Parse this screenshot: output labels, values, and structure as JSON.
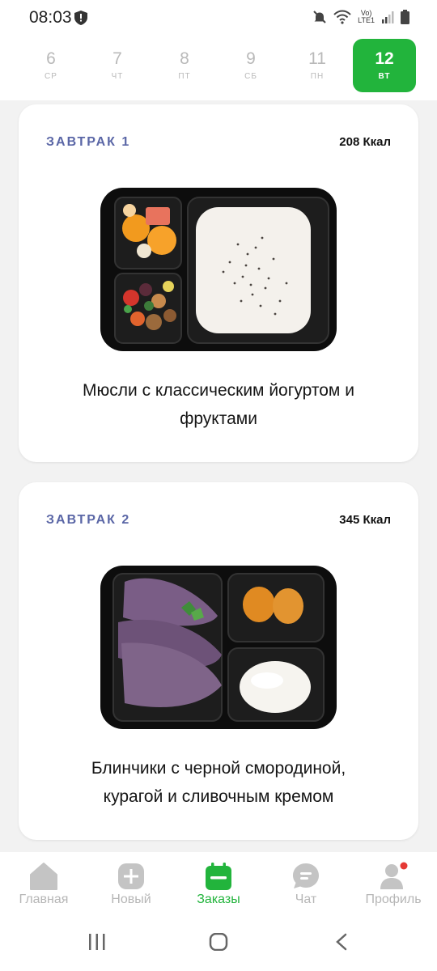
{
  "status": {
    "time": "08:03",
    "network_line1": "Vo)",
    "network_line2": "LTE1"
  },
  "days": [
    {
      "num": "6",
      "name": "СР",
      "active": false
    },
    {
      "num": "7",
      "name": "ЧТ",
      "active": false
    },
    {
      "num": "8",
      "name": "ПТ",
      "active": false
    },
    {
      "num": "9",
      "name": "СБ",
      "active": false
    },
    {
      "num": "11",
      "name": "ПН",
      "active": false
    },
    {
      "num": "12",
      "name": "ВТ",
      "active": true
    }
  ],
  "meals": [
    {
      "type": "ЗАВТРАК 1",
      "kcal": "208 Ккал",
      "name_line1": "Мюсли с классическим йогуртом и",
      "name_line2": "фруктами"
    },
    {
      "type": "ЗАВТРАК 2",
      "kcal": "345 Ккал",
      "name_line1": "Блинчики с черной смородиной,",
      "name_line2": "курагой и сливочным кремом"
    }
  ],
  "nav": [
    {
      "label": "Главная",
      "icon": "home-icon",
      "active": false
    },
    {
      "label": "Новый",
      "icon": "plus-icon",
      "active": false
    },
    {
      "label": "Заказы",
      "icon": "calendar-icon",
      "active": true
    },
    {
      "label": "Чат",
      "icon": "chat-icon",
      "active": false
    },
    {
      "label": "Профиль",
      "icon": "profile-icon",
      "active": false
    }
  ],
  "colors": {
    "accent": "#22b43c",
    "meal_type": "#5a66a6",
    "inactive": "#b6b6b6",
    "notification": "#e53935"
  }
}
